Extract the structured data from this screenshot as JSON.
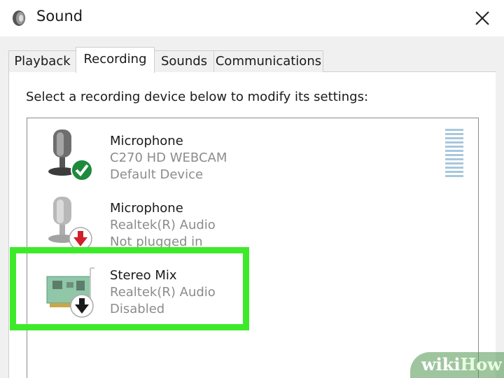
{
  "window": {
    "title": "Sound",
    "icon": "speaker-icon",
    "close_icon": "close-icon"
  },
  "tabs": [
    {
      "label": "Playback",
      "active": false
    },
    {
      "label": "Recording",
      "active": true
    },
    {
      "label": "Sounds",
      "active": false
    },
    {
      "label": "Communications",
      "active": false
    }
  ],
  "instruction": "Select a recording device below to modify its settings:",
  "devices": [
    {
      "name": "Microphone",
      "detail": "C270 HD WEBCAM",
      "status": "Default Device",
      "icon": "microphone-icon",
      "badge": "check-icon",
      "badge_color": "#1e8a3c"
    },
    {
      "name": "Microphone",
      "detail": "Realtek(R) Audio",
      "status": "Not plugged in",
      "icon": "microphone-icon",
      "badge": "down-arrow-icon",
      "badge_color": "#d0212a"
    },
    {
      "name": "Stereo Mix",
      "detail": "Realtek(R) Audio",
      "status": "Disabled",
      "icon": "sound-card-icon",
      "badge": "down-arrow-icon",
      "badge_color": "#1a1a1a"
    }
  ],
  "highlight_color": "#3dea2a",
  "watermark": {
    "part1": "wiki",
    "part2": "How"
  }
}
